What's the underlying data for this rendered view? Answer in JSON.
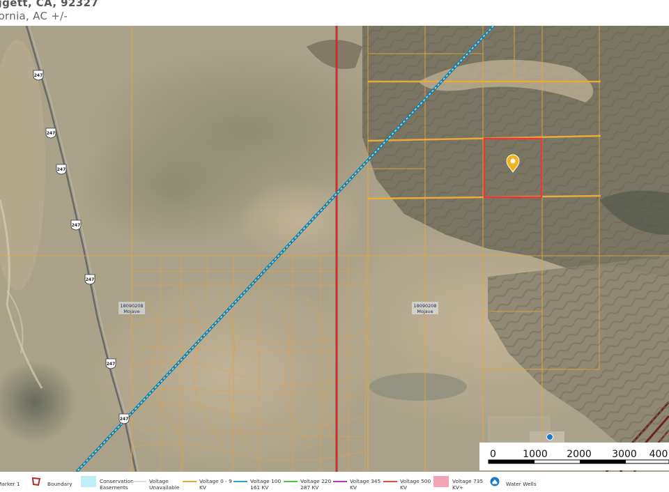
{
  "header": {
    "title": "ggett, CA, 92327",
    "subtitle": "fornia,  AC +/-"
  },
  "map": {
    "highway_shield": "247",
    "zone_labels": [
      {
        "code": "18090208",
        "name": "Mojave"
      },
      {
        "code": "18090208",
        "name": "Mojave"
      }
    ]
  },
  "scale": {
    "ticks": [
      "0",
      "1000",
      "2000",
      "3000",
      "400"
    ]
  },
  "legend": [
    {
      "label": "Marker 1",
      "icon": "marker-icon"
    },
    {
      "label": "Boundary",
      "icon": "boundary-polygon-icon",
      "color": "#b3262a"
    },
    {
      "label": "Conservation Easements",
      "icon": "conservation-swatch",
      "color": "#bfeff5"
    },
    {
      "label": "Voltage Unavailable",
      "icon": "voltage-line",
      "color": "#dcdcdc"
    },
    {
      "label": "Voltage 0 - 9 KV",
      "icon": "voltage-line",
      "color": "#e3a33a"
    },
    {
      "label": "Voltage 100 161 KV",
      "icon": "voltage-line",
      "color": "#2aa7c4"
    },
    {
      "label": "Voltage 220 287 KV",
      "icon": "voltage-line",
      "color": "#4cc93a"
    },
    {
      "label": "Voltage 345 KV",
      "icon": "voltage-line",
      "color": "#b23ab0"
    },
    {
      "label": "Voltage 500 KV",
      "icon": "voltage-line",
      "color": "#d9532e"
    },
    {
      "label": "Voltage  735 KV+",
      "icon": "voltage-swatch",
      "color": "#f4a3b4"
    },
    {
      "label": "Water Wells",
      "icon": "water-well-icon",
      "color": "#1c78c9"
    }
  ],
  "colors": {
    "parcel_lines": "#e8a640",
    "boundary": "#e23a3a",
    "power_line_red": "#c42f2f",
    "power_line_blue": "#2e9ec7",
    "marker": "#f2b520"
  }
}
